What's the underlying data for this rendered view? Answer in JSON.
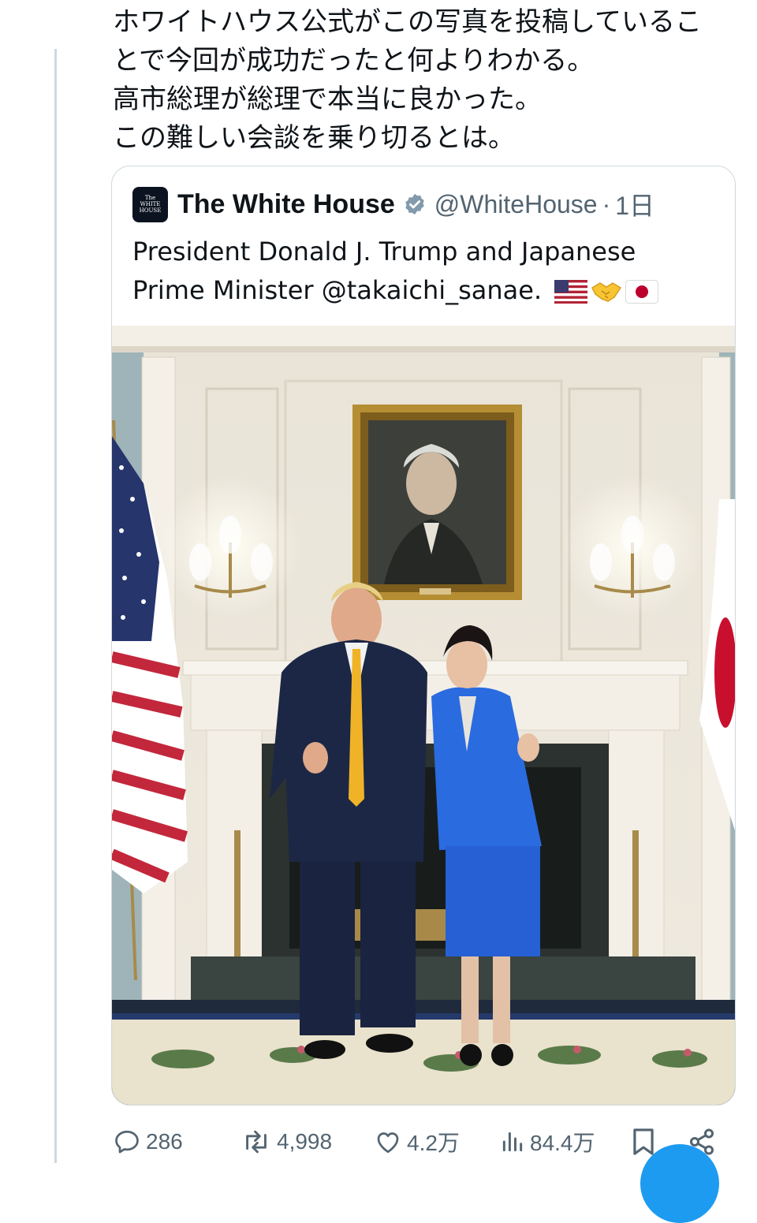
{
  "post": {
    "lines": [
      "ホワイトハウス公式がこの写真を投稿しているこ",
      "とで今回が成功だったと何よりわかる。",
      "高市総理が総理で本当に良かった。",
      "この難しい会談を乗り切るとは。"
    ]
  },
  "quote": {
    "avatar_text_1": "The",
    "avatar_text_2": "WHITE",
    "avatar_text_3": "HOUSE",
    "name": "The White House",
    "handle": "@WhiteHouse",
    "separator": "·",
    "time": "1日",
    "text_line_1": "President Donald J. Trump and Japanese",
    "text_line_2": "Prime Minister @takaichi_sanae.",
    "emojis": [
      "us-flag-icon",
      "handshake-icon",
      "japan-flag-icon"
    ]
  },
  "actions": {
    "replies": "286",
    "reposts": "4,998",
    "likes": "4.2万",
    "views": "84.4万"
  },
  "colors": {
    "text": "#0f1419",
    "secondary": "#536471",
    "border": "#cfd9de",
    "accent": "#1d9bf0",
    "wall": "#efeadf"
  }
}
